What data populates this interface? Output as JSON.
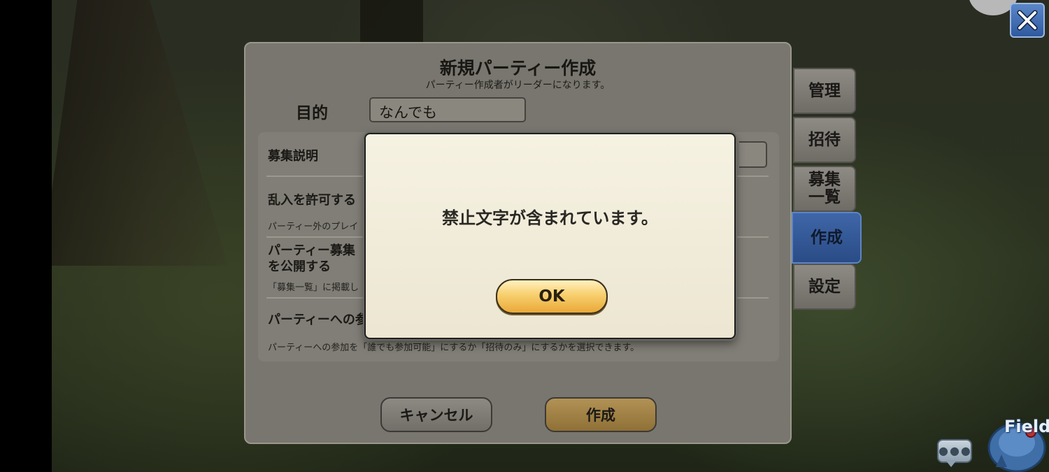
{
  "panel": {
    "title": "新規パーティー作成",
    "subtitle": "パーティー作成者がリーダーになります。",
    "purpose_label": "目的",
    "purpose_value": "なんでも",
    "settings": {
      "recruit_description_label": "募集説明",
      "allow_intrusion_label": "乱入を許可する",
      "allow_intrusion_desc": "パーティー外のプレイ",
      "publish_recruit_label_line1": "パーティー募集",
      "publish_recruit_label_line2": "を公開する",
      "publish_recruit_desc": "「募集一覧」に掲載し",
      "join_setting_label": "パーティーへの参",
      "join_setting_desc": "パーティーへの参加を「誰でも参加可能」にするか「招待のみ」にするかを選択できます。"
    },
    "cancel_label": "キャンセル",
    "create_label": "作成"
  },
  "side_tabs": [
    {
      "label": "管理"
    },
    {
      "label": "招待"
    },
    {
      "label_line1": "募集",
      "label_line2": "一覧"
    },
    {
      "label": "作成",
      "active": true
    },
    {
      "label": "設定"
    }
  ],
  "modal": {
    "message": "禁止文字が含まれています。",
    "ok_label": "OK"
  },
  "hud": {
    "field_label": "Field",
    "close_icon": "close-icon",
    "chat_icon": "chat-bubble-icon"
  },
  "colors": {
    "active_tab": "#3f66a8",
    "ok_button": "#f7cf6e",
    "create_button": "#b29255"
  }
}
